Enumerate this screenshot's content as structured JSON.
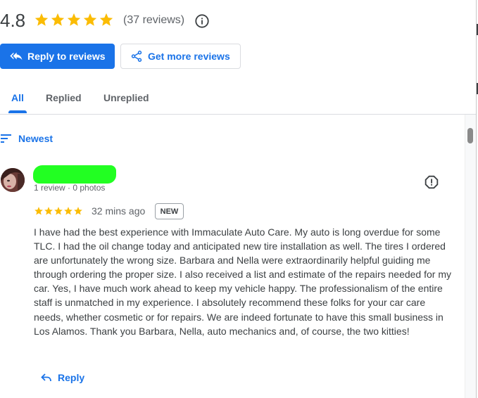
{
  "summary": {
    "rating": "4.8",
    "stars": 5,
    "review_count_text": "(37 reviews)"
  },
  "actions": {
    "reply_to_reviews": "Reply to reviews",
    "get_more_reviews": "Get more reviews"
  },
  "tabs": [
    {
      "label": "All",
      "active": true
    },
    {
      "label": "Replied",
      "active": false
    },
    {
      "label": "Unreplied",
      "active": false
    }
  ],
  "sort": {
    "label": "Newest"
  },
  "review": {
    "reviewer_meta": "1 review · 0 photos",
    "stars": 5,
    "time": "32 mins ago",
    "badge": "NEW",
    "text": "I have had the best experience with Immaculate Auto Care. My auto is long overdue for some TLC. I had the oil change today and anticipated new tire installation as well. The tires I ordered are unfortunately the wrong size. Barbara and Nella were extraordinarily helpful guiding me through ordering the proper size. I also received a list and estimate of the repairs needed for my car. Yes, I have much work ahead to keep my vehicle happy. The professionalism of the entire staff is unmatched in my experience. I absolutely recommend these folks for your car care needs, whether cosmetic or for repairs. We are indeed fortunate to have this small business in Los Alamos. Thank you Barbara, Nella, auto mechanics and, of course, the two kitties!",
    "reply_label": "Reply"
  },
  "colors": {
    "accent": "#1a73e8",
    "star": "#fbbc04",
    "redaction": "#22ff22"
  },
  "icons": [
    "star-icon",
    "info-icon",
    "reply-icon",
    "share-icon",
    "sort-icon",
    "flag-icon"
  ]
}
